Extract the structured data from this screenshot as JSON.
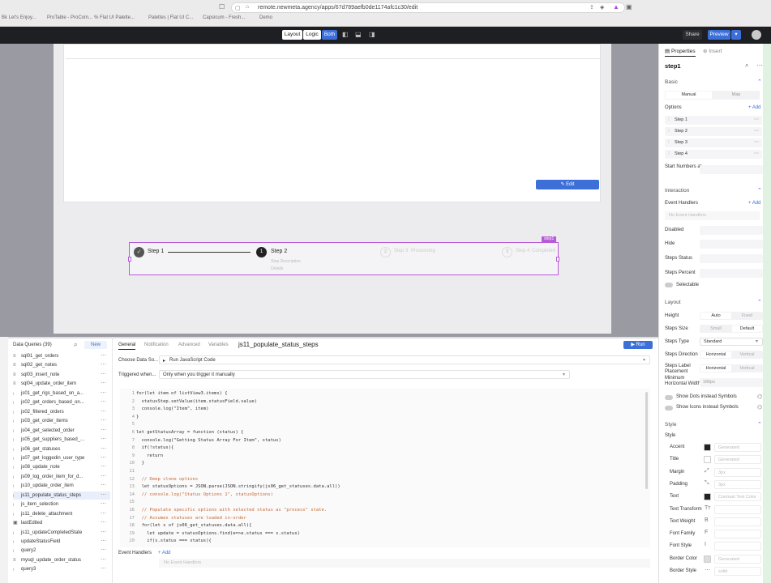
{
  "browser": {
    "url": "remote.newmeta.agency/apps/67d789aefb0de1174afc1c30/edit",
    "bookmarks": [
      "Bk Let's Enjoy...",
      "ProTable - ProCom...",
      "% Flat UI Palette...",
      "Palettes | Flat UI C...",
      "Capsicum - Fresh...",
      "Demo"
    ]
  },
  "appbar": {
    "mode_layout": "Layout",
    "mode_logic": "Logic",
    "mode_both": "Both",
    "share": "Share",
    "preview": "Preview"
  },
  "canvas": {
    "edit_button": "Edit",
    "component_tag": "step1",
    "steps": [
      {
        "label": "Step 1"
      },
      {
        "label": "Step 2",
        "number": "1",
        "sub": "Step Description"
      },
      {
        "label": "Step 3",
        "number": "2",
        "sub": "Processing"
      },
      {
        "label": "Step 4",
        "number": "3",
        "sub": "Completed"
      }
    ],
    "step2_desc2": "Details"
  },
  "queries": {
    "header": "Data Queries (39)",
    "new_button": "New",
    "items": [
      {
        "icon": "sql",
        "name": "sql01_get_orders"
      },
      {
        "icon": "sql",
        "name": "sql02_get_notes"
      },
      {
        "icon": "sql",
        "name": "sql03_insert_note"
      },
      {
        "icon": "sql",
        "name": "sql04_update_order_item"
      },
      {
        "icon": "js",
        "name": "js01_get_rigs_based_on_a..."
      },
      {
        "icon": "js",
        "name": "js02_get_orders_based_on..."
      },
      {
        "icon": "js",
        "name": "js02_filtered_orders"
      },
      {
        "icon": "js",
        "name": "js03_get_order_items"
      },
      {
        "icon": "js",
        "name": "js04_get_selected_order"
      },
      {
        "icon": "js",
        "name": "js05_get_suppliers_based_..."
      },
      {
        "icon": "js",
        "name": "js06_get_statuses"
      },
      {
        "icon": "js",
        "name": "js07_get_loggedin_user_type"
      },
      {
        "icon": "js",
        "name": "js08_update_note"
      },
      {
        "icon": "js",
        "name": "js09_log_order_item_for_d..."
      },
      {
        "icon": "js",
        "name": "js10_update_order_item"
      },
      {
        "icon": "js",
        "name": "js11_populate_status_steps"
      },
      {
        "icon": "js",
        "name": "js_item_selection"
      },
      {
        "icon": "js",
        "name": "js11_delete_attachment"
      },
      {
        "icon": "var",
        "name": "lastEdited"
      },
      {
        "icon": "js",
        "name": "js11_updateCompletedState"
      },
      {
        "icon": "js",
        "name": "updateStatusField"
      },
      {
        "icon": "js",
        "name": "query2"
      },
      {
        "icon": "sql",
        "name": "mysql_update_order_status"
      },
      {
        "icon": "js",
        "name": "query3"
      }
    ],
    "tabs": [
      "General",
      "Notification",
      "Advanced",
      "Variables"
    ],
    "title": "js11_populate_status_steps",
    "run": "Run",
    "choose_label": "Choose Data So...",
    "choose_value": "Run JavaScript Code",
    "trigger_label": "Triggered when...",
    "trigger_value": "Only when you trigger it manually",
    "event_handlers": "Event Handlers",
    "add": "+ Add",
    "no_handlers": "No Event Handlers"
  },
  "code": [
    "for(let item of listView3.items) {",
    "  statusStep.setValue(item.statusField.value)",
    "  console.log(\"Item\", item)",
    "}",
    "",
    "let getStatusArray = function (status) {",
    "  console.log(\"Getting Status Array For Item\", status)",
    "  if(!status){",
    "    return",
    "  }",
    "",
    "  // Deep clone options",
    "  let statusOptions = JSON.parse(JSON.stringify(js06_get_statuses.data.all))",
    "  // console.log(\"Status Options 1\", statusOptions)",
    "",
    "  // Populate specific options with selected status as \"process\" state.",
    "  // Assumes statuses are loaded in-order",
    "  for(let s of js06_get_statuses.data.all){",
    "    let update = statusOptions.find(e=>e.status === s.status)",
    "    if(s.status === status){"
  ],
  "props": {
    "tab_properties": "Properties",
    "tab_insert": "Insert",
    "component": "step1",
    "basic": "Basic",
    "manual": "Manual",
    "map": "Map",
    "options": "Options",
    "add": "+ Add",
    "option_items": [
      "Step 1",
      "Step 2",
      "Step 3",
      "Step 4"
    ],
    "start_numbers": "Start Numbers at",
    "interaction": "Interaction",
    "event_handlers": "Event Handlers",
    "no_event_handlers": "No Event Handlers",
    "disabled": "Disabled",
    "hide": "Hide",
    "steps_status": "Steps Status",
    "steps_percent": "Steps Percent",
    "selectable": "Selectable",
    "layout": "Layout",
    "height": "Height",
    "height_auto": "Auto",
    "height_fixed": "Fixed",
    "steps_size": "Steps Size",
    "size_small": "Small",
    "size_default": "Default",
    "steps_type": "Steps Type",
    "steps_type_value": "Standard",
    "steps_direction": "Steps Direction",
    "horizontal": "Horizontal",
    "vertical": "Vertical",
    "steps_label_placement": "Steps Label Placement",
    "min_width": "Minimum Horizontal Width",
    "min_width_value": "180px",
    "show_dots": "Show Dots instead Symbols",
    "show_icons": "Show Icons instead Symbols",
    "style_section": "Style",
    "style": "Style",
    "accent": "Accent",
    "title": "Title",
    "margin": "Margin",
    "padding": "Padding",
    "text": "Text",
    "text_transform": "Text Transform",
    "text_weight": "Text Weight",
    "font_family": "Font Family",
    "font_style": "Font Style",
    "border_color": "Border Color",
    "border_style": "Border Style",
    "generated": "Generated",
    "margin_value": "3px",
    "padding_value": "3px",
    "contrast_text": "Contrast Text Color",
    "solid": "solid"
  },
  "colors": {
    "accent": "#3d6fd8",
    "purple": "#b85ad8"
  }
}
